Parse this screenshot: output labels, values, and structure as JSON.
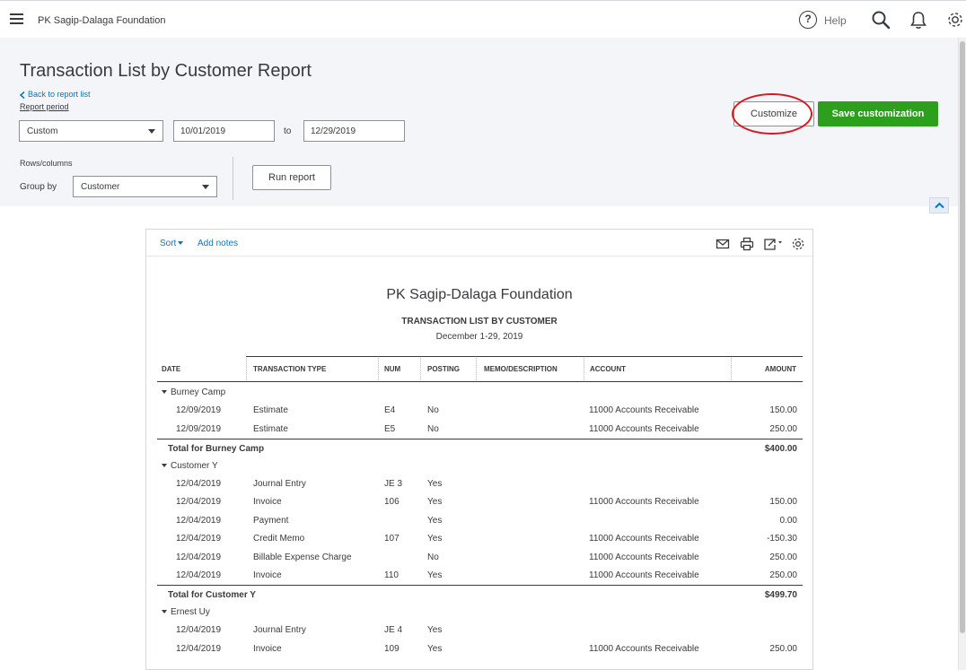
{
  "topbar": {
    "company_name": "PK Sagip-Dalaga Foundation",
    "help_glyph": "?",
    "help_label": "Help"
  },
  "header": {
    "title": "Transaction List by Customer Report",
    "back_link": "Back to report list",
    "report_period_label": "Report period",
    "period_value": "Custom",
    "date_from": "10/01/2019",
    "to_label": "to",
    "date_to": "12/29/2019",
    "rows_columns_label": "Rows/columns",
    "group_by_label": "Group by",
    "group_by_value": "Customer",
    "run_report": "Run report",
    "customize": "Customize",
    "save_customization": "Save customization"
  },
  "report_toolbar": {
    "sort": "Sort",
    "add_notes": "Add notes"
  },
  "report": {
    "company": "PK Sagip-Dalaga Foundation",
    "title": "TRANSACTION LIST BY CUSTOMER",
    "date_range": "December 1-29, 2019",
    "columns": {
      "date": "DATE",
      "type": "TRANSACTION TYPE",
      "num": "NUM",
      "posting": "POSTING",
      "memo": "MEMO/DESCRIPTION",
      "account": "ACCOUNT",
      "amount": "AMOUNT"
    },
    "rows": [
      {
        "kind": "group",
        "label": "Burney Camp"
      },
      {
        "kind": "data",
        "date": "12/09/2019",
        "type": "Estimate",
        "num": "E4",
        "posting": "No",
        "account": "11000 Accounts Receivable",
        "amount": "150.00"
      },
      {
        "kind": "data",
        "date": "12/09/2019",
        "type": "Estimate",
        "num": "E5",
        "posting": "No",
        "account": "11000 Accounts Receivable",
        "amount": "250.00"
      },
      {
        "kind": "total",
        "label": "Total for Burney Camp",
        "amount": "$400.00"
      },
      {
        "kind": "group",
        "label": "Customer Y"
      },
      {
        "kind": "data",
        "date": "12/04/2019",
        "type": "Journal Entry",
        "num": "JE 3",
        "posting": "Yes",
        "account": "",
        "amount": ""
      },
      {
        "kind": "data",
        "date": "12/04/2019",
        "type": "Invoice",
        "num": "106",
        "posting": "Yes",
        "account": "11000 Accounts Receivable",
        "amount": "150.00"
      },
      {
        "kind": "data",
        "date": "12/04/2019",
        "type": "Payment",
        "num": "",
        "posting": "Yes",
        "account": "",
        "amount": "0.00"
      },
      {
        "kind": "data",
        "date": "12/04/2019",
        "type": "Credit Memo",
        "num": "107",
        "posting": "Yes",
        "account": "11000 Accounts Receivable",
        "amount": "-150.30"
      },
      {
        "kind": "data",
        "date": "12/04/2019",
        "type": "Billable Expense Charge",
        "num": "",
        "posting": "No",
        "account": "11000 Accounts Receivable",
        "amount": "250.00"
      },
      {
        "kind": "data",
        "date": "12/04/2019",
        "type": "Invoice",
        "num": "110",
        "posting": "Yes",
        "account": "11000 Accounts Receivable",
        "amount": "250.00"
      },
      {
        "kind": "total",
        "label": "Total for Customer Y",
        "amount": "$499.70"
      },
      {
        "kind": "group",
        "label": "Ernest Uy"
      },
      {
        "kind": "data",
        "date": "12/04/2019",
        "type": "Journal Entry",
        "num": "JE 4",
        "posting": "Yes",
        "account": "",
        "amount": ""
      },
      {
        "kind": "data",
        "date": "12/04/2019",
        "type": "Invoice",
        "num": "109",
        "posting": "Yes",
        "account": "11000 Accounts Receivable",
        "amount": "250.00"
      }
    ]
  },
  "colors": {
    "accent_green": "#2ca01c",
    "link_blue": "#0077c5",
    "highlight_red": "#e0141c",
    "panel_grey": "#f4f5f8"
  },
  "icons": [
    "menu-icon",
    "help-icon",
    "search-icon",
    "bell-icon",
    "gear-icon",
    "email-icon",
    "print-icon",
    "export-icon",
    "chevron-up-icon"
  ]
}
